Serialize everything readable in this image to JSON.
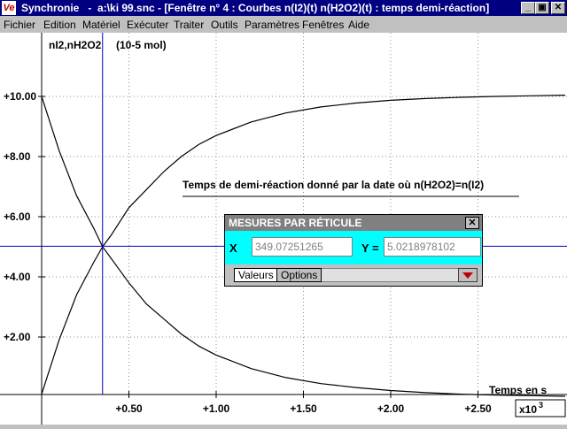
{
  "window": {
    "app_name": "Synchronie",
    "title_text": "Synchronie   -  a:\\ki 99.snc - [Fenêtre n° 4 : Courbes n(I2)(t) n(H2O2)(t) : temps demi-réaction]",
    "icon_text": "Ve",
    "minimize_glyph": "_",
    "restore_glyph": "▣",
    "close_glyph": "✕"
  },
  "menu": {
    "items": [
      "Fichier",
      "Edition",
      "Matériel",
      "Exécuter",
      "Traiter",
      "Outils",
      "Paramètres",
      "Fenêtres",
      "Aide"
    ]
  },
  "plot": {
    "y_label": "nI2,nH2O2",
    "y_unit": "(10-5 mol)",
    "x_label": "Temps en s",
    "x_multiplier": "x10",
    "x_multiplier_exp": "3",
    "annotation": "Temps de demi-réaction donné par la date où n(H2O2)=n(I2)"
  },
  "chart_data": {
    "type": "line",
    "xlabel": "Temps en s",
    "ylabel": "nI2,nH2O2",
    "x_ticks": [
      "+0.50",
      "+1.00",
      "+1.50",
      "+2.00",
      "+2.50"
    ],
    "y_ticks": [
      "+2.00",
      "+4.00",
      "+6.00",
      "+8.00",
      "+10.00"
    ],
    "xlim": [
      0,
      3
    ],
    "ylim": [
      -0.6,
      10.4
    ],
    "grid": true,
    "series": [
      {
        "name": "nI2",
        "x": [
          0,
          0.1,
          0.2,
          0.3,
          0.349,
          0.4,
          0.5,
          0.6,
          0.7,
          0.8,
          0.9,
          1.0,
          1.2,
          1.4,
          1.6,
          1.8,
          2.0,
          2.2,
          2.4,
          2.6,
          2.8,
          3.0
        ],
        "values": [
          0.1,
          1.9,
          3.4,
          4.5,
          5.0,
          5.4,
          6.3,
          6.9,
          7.5,
          8.0,
          8.4,
          8.7,
          9.15,
          9.45,
          9.65,
          9.78,
          9.87,
          9.93,
          9.97,
          10.0,
          10.02,
          10.04
        ]
      },
      {
        "name": "nH2O2",
        "x": [
          0,
          0.1,
          0.2,
          0.3,
          0.349,
          0.4,
          0.5,
          0.6,
          0.7,
          0.8,
          0.9,
          1.0,
          1.2,
          1.4,
          1.6,
          1.8,
          2.0,
          2.2,
          2.4,
          2.6,
          2.8,
          3.0
        ],
        "values": [
          10.0,
          8.2,
          6.7,
          5.6,
          5.0,
          4.6,
          3.8,
          3.1,
          2.6,
          2.1,
          1.7,
          1.4,
          0.95,
          0.65,
          0.45,
          0.32,
          0.22,
          0.15,
          0.1,
          0.07,
          0.05,
          0.03
        ]
      }
    ],
    "crosshair": {
      "x": 0.349,
      "y": 5.02
    }
  },
  "measures": {
    "title": "MESURES PAR RÉTICULE",
    "close_glyph": "✕",
    "x_label": "X",
    "y_label": "Y =",
    "x_value": "349.07251265",
    "y_value": "5.0218978102",
    "tabs": [
      "Valeurs",
      "Options"
    ]
  },
  "colors": {
    "titlebar": "#000080",
    "crosshair": "#0000c0",
    "grid": "#909090",
    "panel_body": "#00ffff",
    "dropdown_arrow": "#c00000"
  }
}
